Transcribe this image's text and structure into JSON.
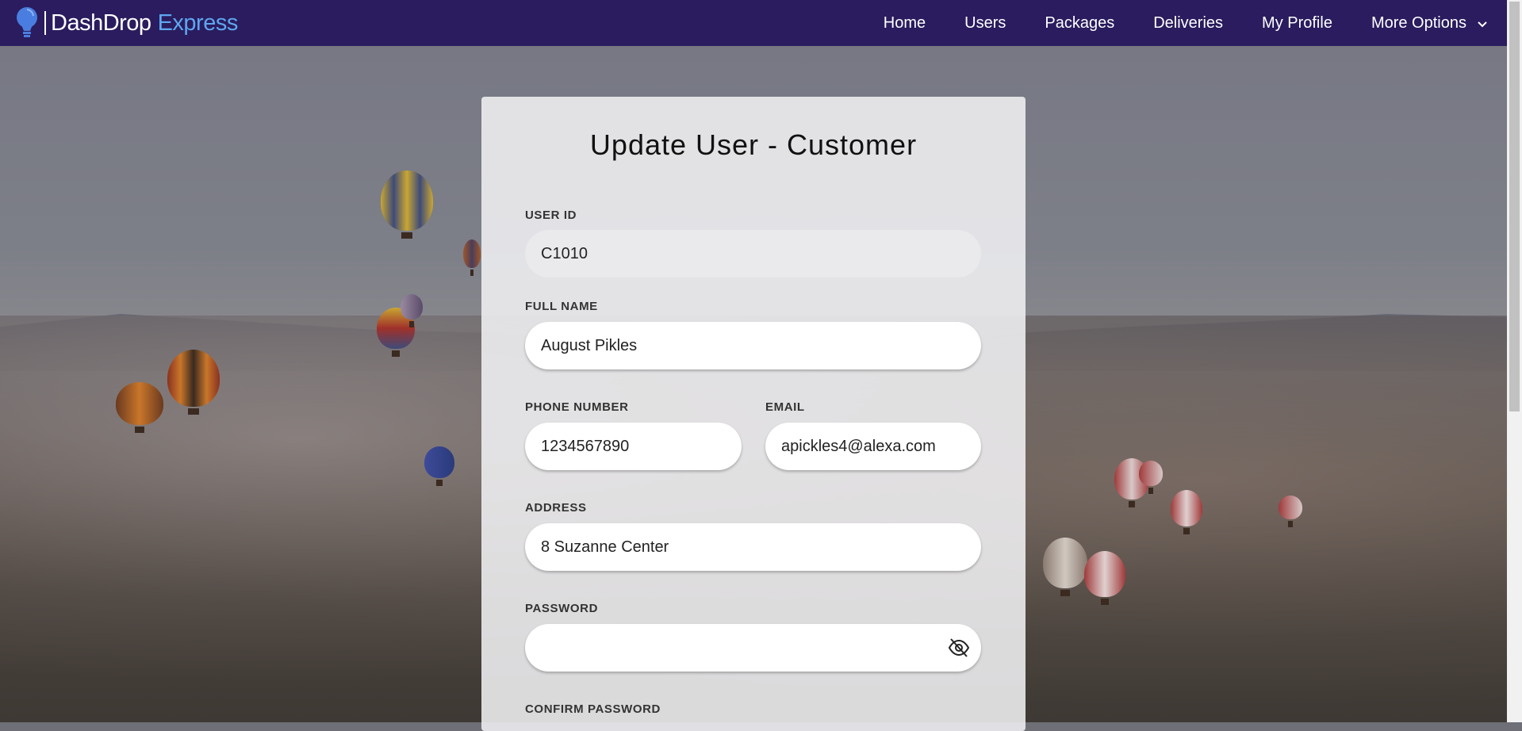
{
  "nav": {
    "brand_name": "DashDrop",
    "brand_accent": "Express",
    "items": [
      "Home",
      "Users",
      "Packages",
      "Deliveries",
      "My Profile",
      "More Options"
    ]
  },
  "form": {
    "title": "Update User - Customer",
    "user_id_label": "USER ID",
    "user_id_value": "C1010",
    "full_name_label": "FULL NAME",
    "full_name_value": "August Pikles",
    "phone_label": "PHONE NUMBER",
    "phone_value": "1234567890",
    "email_label": "EMAIL",
    "email_value": "apickles4@alexa.com",
    "address_label": "ADDRESS",
    "address_value": "8 Suzanne Center",
    "password_label": "PASSWORD",
    "password_value": "",
    "confirm_password_label": "CONFIRM PASSWORD"
  },
  "colors": {
    "navbar": "#2a1c5e",
    "brand_accent": "#5ea6f0"
  },
  "icons": {
    "brand": "lightbulb-icon",
    "more": "chevron-down-icon",
    "password_toggle": "eye-slash-icon"
  }
}
